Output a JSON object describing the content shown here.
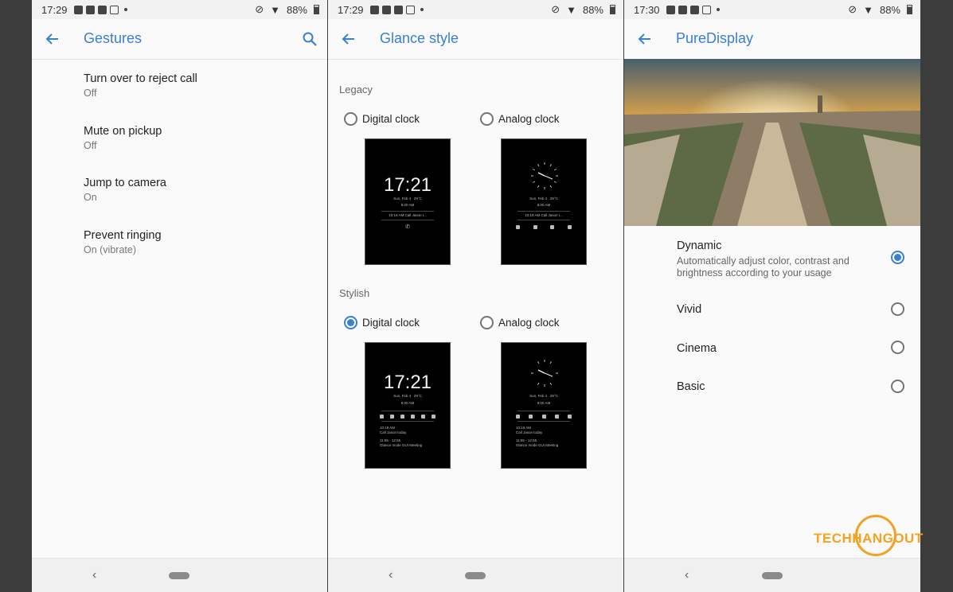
{
  "screens": [
    {
      "status": {
        "time": "17:29",
        "battery": "88%"
      },
      "title": "Gestures",
      "items": [
        {
          "title": "Turn over to reject call",
          "sub": "Off"
        },
        {
          "title": "Mute on pickup",
          "sub": "Off"
        },
        {
          "title": "Jump to camera",
          "sub": "On"
        },
        {
          "title": "Prevent ringing",
          "sub": "On (vibrate)"
        }
      ]
    },
    {
      "status": {
        "time": "17:29",
        "battery": "88%"
      },
      "title": "Glance style",
      "sections": [
        {
          "label": "Legacy",
          "options": [
            {
              "label": "Digital clock",
              "selected": false
            },
            {
              "label": "Analog clock",
              "selected": false
            }
          ]
        },
        {
          "label": "Stylish",
          "options": [
            {
              "label": "Digital clock",
              "selected": true
            },
            {
              "label": "Analog clock",
              "selected": false
            }
          ]
        }
      ],
      "preview": {
        "clock": "17:21",
        "date": "Sun, Feb 4",
        "temp": "29°C",
        "alarm": "8:00 AM",
        "call_line": "10:19 AM Call Jason t...",
        "note1_time": "10:19 AM",
        "note1_text": "Call Jason today",
        "note2_time": "11:55 - 12:55",
        "note2_text": "Glance mode GUI Meeting"
      }
    },
    {
      "status": {
        "time": "17:30",
        "battery": "88%"
      },
      "title": "PureDisplay",
      "options": [
        {
          "title": "Dynamic",
          "desc": "Automatically adjust color, contrast and brightness according to your usage",
          "selected": true
        },
        {
          "title": "Vivid",
          "desc": "",
          "selected": false
        },
        {
          "title": "Cinema",
          "desc": "",
          "selected": false
        },
        {
          "title": "Basic",
          "desc": "",
          "selected": false
        }
      ]
    }
  ],
  "watermark": "TECHHANGOUT",
  "colors": {
    "accent": "#3b7fd1",
    "watermark": "#f6a21e"
  }
}
